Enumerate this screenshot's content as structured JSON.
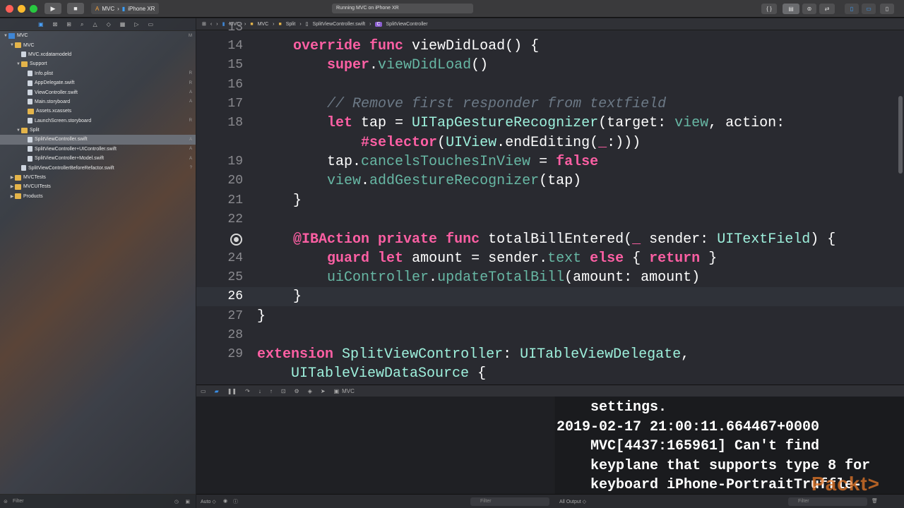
{
  "toolbar": {
    "scheme": "MVC",
    "device": "iPhone XR",
    "activity": "Running MVC on iPhone XR",
    "code_btn": "{ }"
  },
  "navigator": {
    "items": [
      {
        "label": "MVC",
        "kind": "proj",
        "depth": 0,
        "open": true,
        "badge": "M"
      },
      {
        "label": "MVC",
        "kind": "folder",
        "depth": 1,
        "open": true,
        "badge": ""
      },
      {
        "label": "MVC.xcdatamodeld",
        "kind": "file",
        "depth": 2,
        "badge": ""
      },
      {
        "label": "Support",
        "kind": "folder",
        "depth": 2,
        "open": true,
        "badge": ""
      },
      {
        "label": "Info.plist",
        "kind": "file",
        "depth": 3,
        "badge": "R"
      },
      {
        "label": "AppDelegate.swift",
        "kind": "file",
        "depth": 3,
        "badge": "R"
      },
      {
        "label": "ViewController.swift",
        "kind": "file",
        "depth": 3,
        "badge": "A"
      },
      {
        "label": "Main.storyboard",
        "kind": "file",
        "depth": 3,
        "badge": "A"
      },
      {
        "label": "Assets.xcassets",
        "kind": "folder",
        "depth": 3,
        "badge": ""
      },
      {
        "label": "LaunchScreen.storyboard",
        "kind": "file",
        "depth": 3,
        "badge": "R"
      },
      {
        "label": "Split",
        "kind": "folder",
        "depth": 2,
        "open": true,
        "badge": ""
      },
      {
        "label": "SplitViewController.swift",
        "kind": "file",
        "depth": 3,
        "badge": "A",
        "selected": true
      },
      {
        "label": "SplitViewController+UIController.swift",
        "kind": "file",
        "depth": 3,
        "badge": "A"
      },
      {
        "label": "SplitViewController+Model.swift",
        "kind": "file",
        "depth": 3,
        "badge": "A"
      },
      {
        "label": "SplitViewControllerBeforeRefactor.swift",
        "kind": "file",
        "depth": 2,
        "badge": "?"
      },
      {
        "label": "MVCTests",
        "kind": "folder",
        "depth": 1,
        "open": false,
        "badge": ""
      },
      {
        "label": "MVCUITests",
        "kind": "folder",
        "depth": 1,
        "open": false,
        "badge": ""
      },
      {
        "label": "Products",
        "kind": "folder",
        "depth": 1,
        "open": false,
        "badge": ""
      }
    ],
    "filter_placeholder": "Filter"
  },
  "jumpbar": {
    "crumbs": [
      "MVC",
      "MVC",
      "Split",
      "SplitViewController.swift",
      "SplitViewController"
    ]
  },
  "editor": {
    "current_line": "26",
    "lines": [
      {
        "n": "13",
        "html": ""
      },
      {
        "n": "14",
        "html": "<span class='kw'>override</span> <span class='kw'>func</span> viewDidLoad() {"
      },
      {
        "n": "15",
        "html": "    <span class='kw'>super</span>.<span class='pr'>viewDidLoad</span>()"
      },
      {
        "n": "16",
        "html": ""
      },
      {
        "n": "17",
        "html": "    <span class='cm'>// Remove first responder from textfield</span>"
      },
      {
        "n": "18",
        "html": "    <span class='kw'>let</span> tap = <span class='ty'>UITapGestureRecognizer</span>(target: <span class='pr'>view</span>, action:"
      },
      {
        "n": "",
        "html": "        <span class='kw'>#selector</span>(<span class='ty'>UIView</span>.endEditing(<span class='kw'>_</span>:)))"
      },
      {
        "n": "19",
        "html": "    tap.<span class='pr'>cancelsTouchesInView</span> = <span class='kw'>false</span>"
      },
      {
        "n": "20",
        "html": "    <span class='pr'>view</span>.<span class='pr'>addGestureRecognizer</span>(tap)"
      },
      {
        "n": "21",
        "html": "}"
      },
      {
        "n": "22",
        "html": ""
      },
      {
        "n": "23",
        "html": "<span class='kw'>@IBAction</span> <span class='kw'>private</span> <span class='kw'>func</span> totalBillEntered(<span class='kw'>_</span> sender: <span class='ty'>UITextField</span>) {",
        "bp": true
      },
      {
        "n": "24",
        "html": "    <span class='kw'>guard</span> <span class='kw'>let</span> amount = sender.<span class='pr'>text</span> <span class='kw'>else</span> { <span class='kw'>return</span> }"
      },
      {
        "n": "25",
        "html": "    <span class='pr'>uiController</span>.<span class='pr'>updateTotalBill</span>(amount: amount)"
      },
      {
        "n": "26",
        "html": "}",
        "current": true
      },
      {
        "n": "27",
        "html": "}",
        "outer": true
      },
      {
        "n": "28",
        "html": "",
        "outer": true
      },
      {
        "n": "29",
        "html": "<span class='kw'>extension</span> <span class='ty'>SplitViewController</span>: <span class='ty'>UITableViewDelegate</span>,",
        "outer": true
      },
      {
        "n": "",
        "html": "    <span class='ty'>UITableViewDataSource</span> {",
        "outer": true
      }
    ]
  },
  "debugbar": {
    "target": "MVC"
  },
  "console": {
    "lines": [
      "    settings.",
      "2019-02-17 21:00:11.664467+0000",
      "    MVC[4437:165961] Can't find",
      "    keyplane that supports type 8 for",
      "    keyboard iPhone-PortraitTruffle-"
    ]
  },
  "bottom": {
    "auto": "Auto ◇",
    "filter_left": "Filter",
    "all_output": "All Output ◇",
    "filter_right": "Filter"
  },
  "watermark": "Packt>",
  "colors": {
    "keyword": "#fc5fa3",
    "type": "#9ef1dd",
    "property": "#67b7a4",
    "comment": "#6c7986"
  }
}
